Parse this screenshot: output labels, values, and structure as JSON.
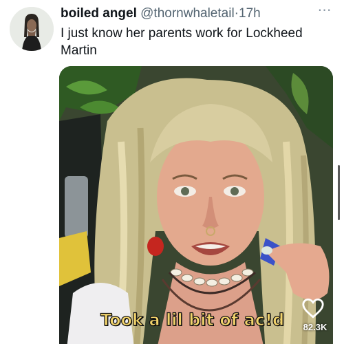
{
  "tweet": {
    "display_name": "boiled angel",
    "handle": "@thornwhaletail",
    "separator": "·",
    "time": "17h",
    "text": "I just know her parents work for Lockheed Martin",
    "more_icon": "more-horizontal-icon"
  },
  "media": {
    "caption": "Took a lil bit of ac!d",
    "like_icon": "heart-outline-icon",
    "like_count": "82.3K"
  },
  "colors": {
    "text_primary": "#0f1419",
    "text_secondary": "#536471",
    "caption_fill": "#f2d36b"
  }
}
